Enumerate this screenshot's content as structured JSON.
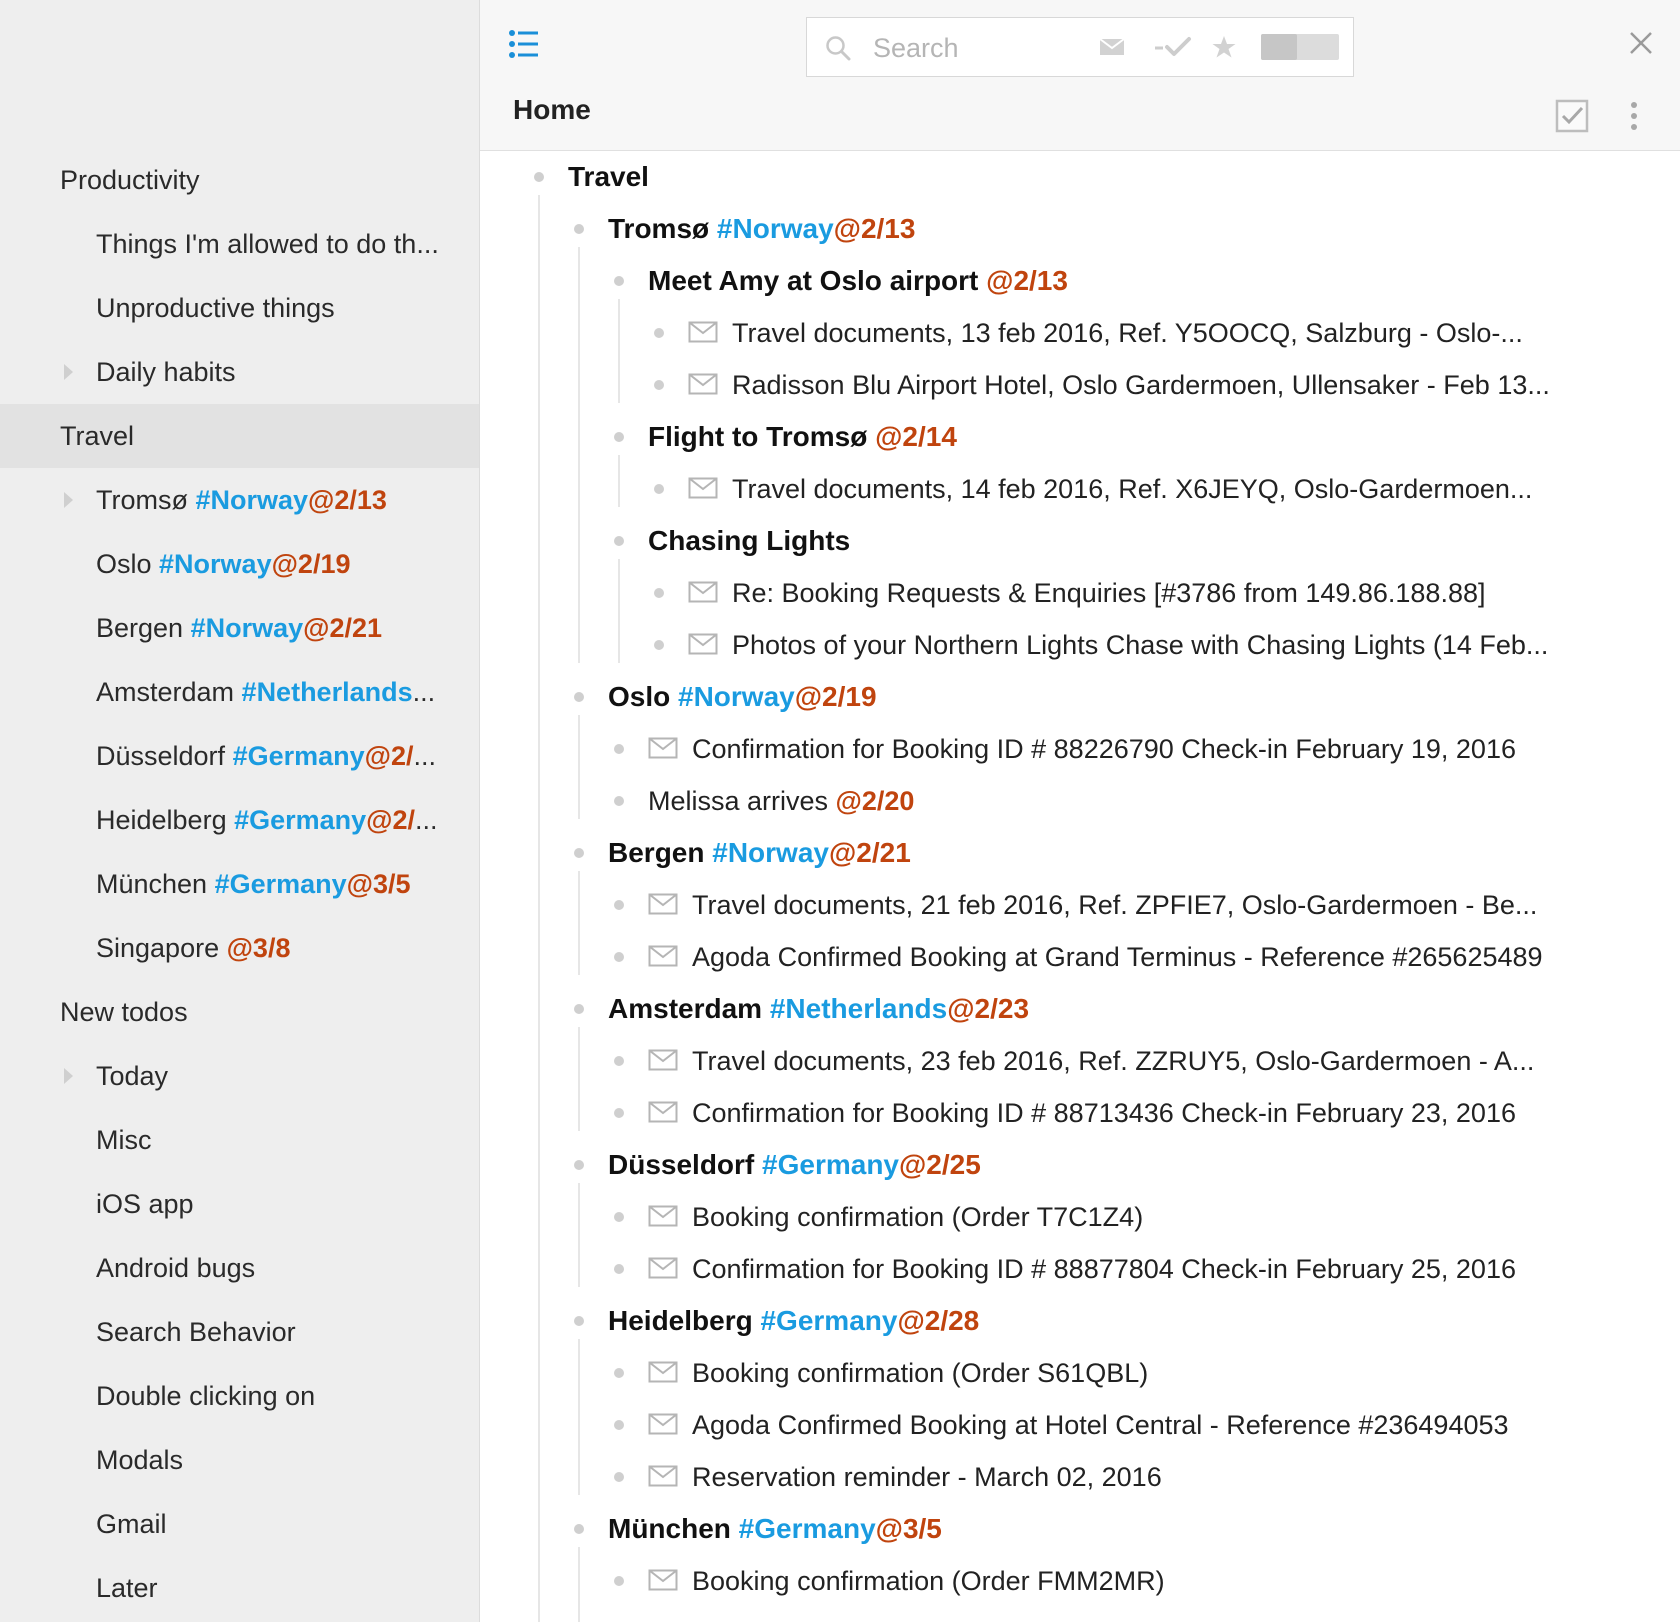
{
  "sidebar": {
    "items": [
      {
        "level": 0,
        "arrow": false,
        "selected": false,
        "text": "Productivity"
      },
      {
        "level": 1,
        "arrow": false,
        "selected": false,
        "text": "Things I'm allowed to do th..."
      },
      {
        "level": 1,
        "arrow": false,
        "selected": false,
        "text": "Unproductive things"
      },
      {
        "level": 1,
        "arrow": true,
        "selected": false,
        "text": "Daily habits"
      },
      {
        "level": 0,
        "arrow": false,
        "selected": true,
        "text": "Travel"
      },
      {
        "level": 1,
        "arrow": true,
        "selected": false,
        "text": "Tromsø ",
        "tag": "#Norway",
        "date": "@2/13"
      },
      {
        "level": 1,
        "arrow": false,
        "selected": false,
        "text": "Oslo ",
        "tag": "#Norway",
        "date": "@2/19"
      },
      {
        "level": 1,
        "arrow": false,
        "selected": false,
        "text": "Bergen ",
        "tag": "#Norway",
        "date": "@2/21"
      },
      {
        "level": 1,
        "arrow": false,
        "selected": false,
        "text": "Amsterdam ",
        "tag": "#Netherlands",
        "date": "",
        "suffix": "..."
      },
      {
        "level": 1,
        "arrow": false,
        "selected": false,
        "text": "Düsseldorf ",
        "tag": "#Germany",
        "date": "@2/",
        "suffix": "..."
      },
      {
        "level": 1,
        "arrow": false,
        "selected": false,
        "text": "Heidelberg ",
        "tag": "#Germany",
        "date": "@2/",
        "suffix": "..."
      },
      {
        "level": 1,
        "arrow": false,
        "selected": false,
        "text": "München ",
        "tag": "#Germany",
        "date": "@3/5"
      },
      {
        "level": 1,
        "arrow": false,
        "selected": false,
        "text": "Singapore ",
        "date": "@3/8"
      },
      {
        "level": 0,
        "arrow": false,
        "selected": false,
        "text": "New todos"
      },
      {
        "level": 1,
        "arrow": true,
        "selected": false,
        "text": "Today"
      },
      {
        "level": 1,
        "arrow": false,
        "selected": false,
        "text": "Misc"
      },
      {
        "level": 1,
        "arrow": false,
        "selected": false,
        "text": "iOS app"
      },
      {
        "level": 1,
        "arrow": false,
        "selected": false,
        "text": "Android bugs"
      },
      {
        "level": 1,
        "arrow": false,
        "selected": false,
        "text": "Search Behavior"
      },
      {
        "level": 1,
        "arrow": false,
        "selected": false,
        "text": "Double clicking on"
      },
      {
        "level": 1,
        "arrow": false,
        "selected": false,
        "text": "Modals"
      },
      {
        "level": 1,
        "arrow": false,
        "selected": false,
        "text": "Gmail"
      },
      {
        "level": 1,
        "arrow": false,
        "selected": false,
        "text": "Later"
      }
    ]
  },
  "header": {
    "search_placeholder": "Search",
    "title": "Home"
  },
  "colors": {
    "tag": "#1a9be0",
    "date": "#c0440e",
    "accent": "#1a8fd8"
  },
  "tree": [
    {
      "depth": 0,
      "bold": true,
      "mail": false,
      "text": "Travel"
    },
    {
      "depth": 1,
      "bold": true,
      "mail": false,
      "text": "Tromsø ",
      "tag": "#Norway",
      "date": "@2/13"
    },
    {
      "depth": 2,
      "bold": true,
      "mail": false,
      "text": "Meet Amy at Oslo airport ",
      "date": "@2/13"
    },
    {
      "depth": 3,
      "bold": false,
      "mail": true,
      "text": "Travel documents,  13 feb 2016,  Ref. Y5OOCQ,  Salzburg - Oslo-..."
    },
    {
      "depth": 3,
      "bold": false,
      "mail": true,
      "text": "Radisson Blu Airport Hotel, Oslo Gardermoen, Ullensaker - Feb 13..."
    },
    {
      "depth": 2,
      "bold": true,
      "mail": false,
      "text": "Flight to Tromsø ",
      "date": "@2/14"
    },
    {
      "depth": 3,
      "bold": false,
      "mail": true,
      "text": "Travel documents,  14 feb 2016,  Ref. X6JEYQ,  Oslo-Gardermoen..."
    },
    {
      "depth": 2,
      "bold": true,
      "mail": false,
      "text": "Chasing Lights"
    },
    {
      "depth": 3,
      "bold": false,
      "mail": true,
      "text": "Re: Booking Requests & Enquiries [#3786 from 149.86.188.88]"
    },
    {
      "depth": 3,
      "bold": false,
      "mail": true,
      "text": "Photos of your Northern Lights Chase with Chasing Lights (14 Feb..."
    },
    {
      "depth": 1,
      "bold": true,
      "mail": false,
      "text": "Oslo ",
      "tag": "#Norway",
      "date": "@2/19"
    },
    {
      "depth": 2,
      "bold": false,
      "mail": true,
      "text": "Confirmation for Booking ID # 88226790 Check-in February 19, 2016"
    },
    {
      "depth": 2,
      "bold": false,
      "mail": false,
      "text": "Melissa arrives ",
      "date": "@2/20"
    },
    {
      "depth": 1,
      "bold": true,
      "mail": false,
      "text": "Bergen ",
      "tag": "#Norway",
      "date": "@2/21"
    },
    {
      "depth": 2,
      "bold": false,
      "mail": true,
      "text": "Travel documents,  21 feb 2016,  Ref. ZPFIE7,  Oslo-Gardermoen - Be..."
    },
    {
      "depth": 2,
      "bold": false,
      "mail": true,
      "text": "Agoda Confirmed Booking at Grand Terminus  - Reference #265625489"
    },
    {
      "depth": 1,
      "bold": true,
      "mail": false,
      "text": "Amsterdam ",
      "tag": "#Netherlands",
      "date": "@2/23"
    },
    {
      "depth": 2,
      "bold": false,
      "mail": true,
      "text": "Travel documents,  23 feb 2016,  Ref. ZZRUY5,  Oslo-Gardermoen - A..."
    },
    {
      "depth": 2,
      "bold": false,
      "mail": true,
      "text": "Confirmation for Booking ID # 88713436 Check-in February 23, 2016"
    },
    {
      "depth": 1,
      "bold": true,
      "mail": false,
      "text": "Düsseldorf ",
      "tag": "#Germany",
      "date": "@2/25"
    },
    {
      "depth": 2,
      "bold": false,
      "mail": true,
      "text": "Booking confirmation (Order T7C1Z4)"
    },
    {
      "depth": 2,
      "bold": false,
      "mail": true,
      "text": "Confirmation for Booking ID # 88877804 Check-in February 25, 2016"
    },
    {
      "depth": 1,
      "bold": true,
      "mail": false,
      "text": "Heidelberg ",
      "tag": "#Germany",
      "date": "@2/28"
    },
    {
      "depth": 2,
      "bold": false,
      "mail": true,
      "text": "Booking confirmation (Order S61QBL)"
    },
    {
      "depth": 2,
      "bold": false,
      "mail": true,
      "text": "Agoda Confirmed Booking at Hotel Central  - Reference #236494053"
    },
    {
      "depth": 2,
      "bold": false,
      "mail": true,
      "text": "Reservation reminder - March 02, 2016"
    },
    {
      "depth": 1,
      "bold": true,
      "mail": false,
      "text": "München ",
      "tag": "#Germany",
      "date": "@3/5"
    },
    {
      "depth": 2,
      "bold": false,
      "mail": true,
      "text": "Booking confirmation (Order FMM2MR)"
    }
  ]
}
